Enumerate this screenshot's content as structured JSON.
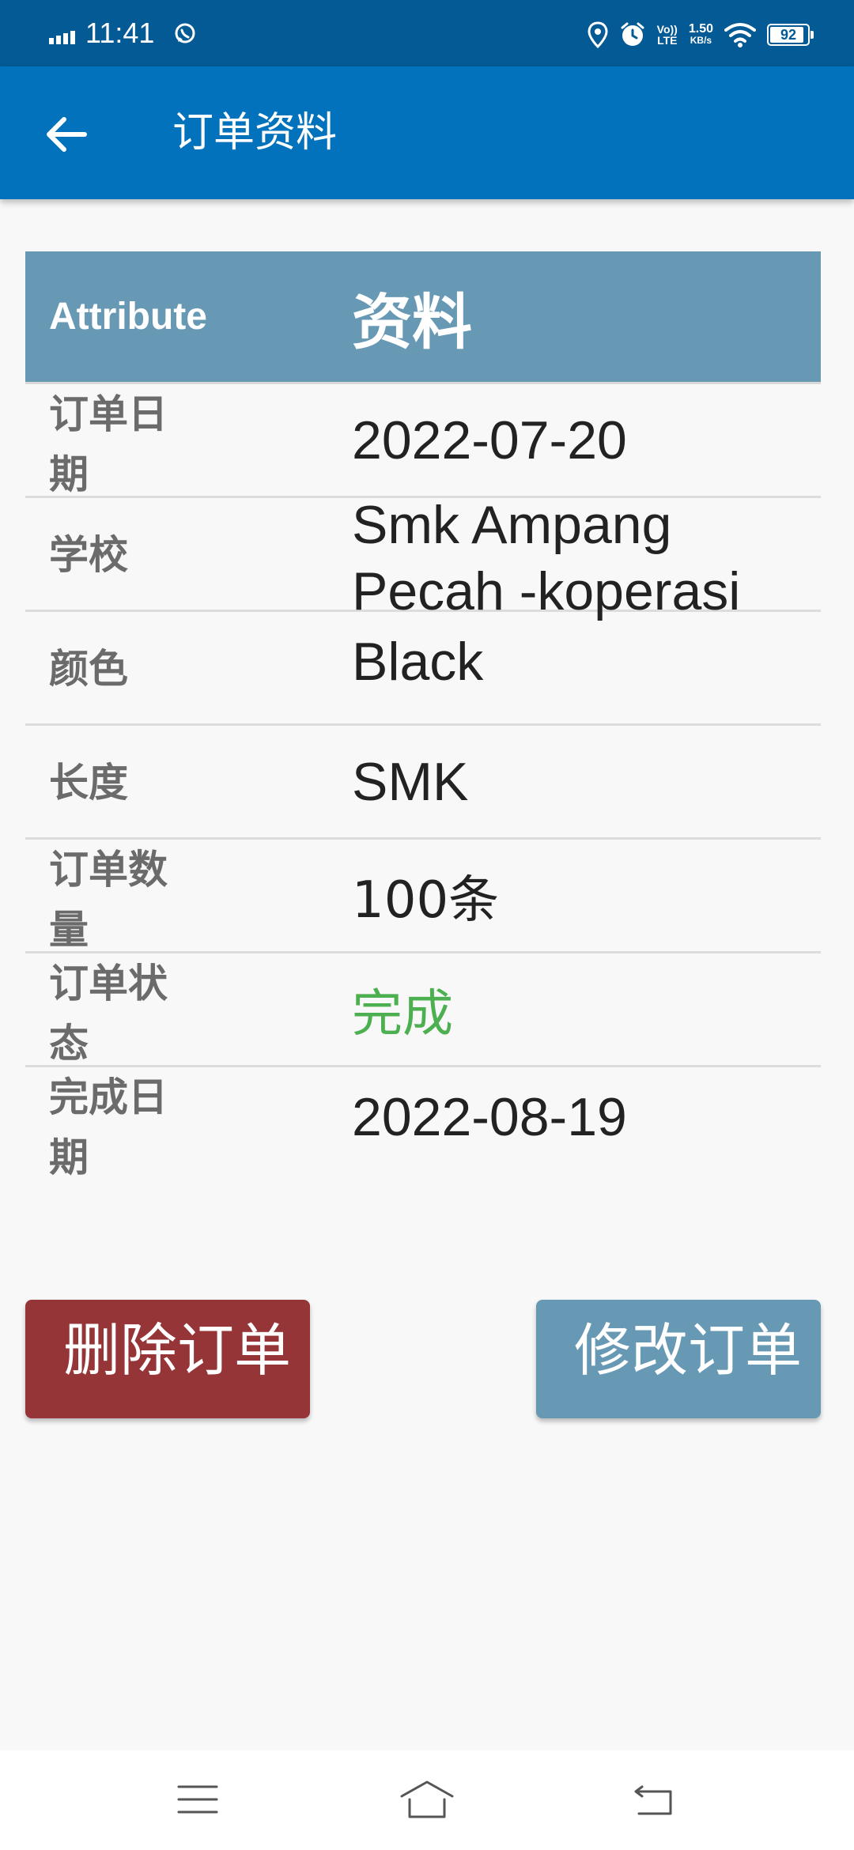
{
  "status_bar": {
    "time": "11:41",
    "net_speed_value": "1.50",
    "net_speed_unit": "KB/s",
    "volte_top": "Vo))",
    "volte_bottom": "LTE",
    "battery": "92",
    "battery_level": 0.92,
    "icons": [
      "signal-icon",
      "whatsapp-icon",
      "location-icon",
      "alarm-icon",
      "volte-icon",
      "wifi-icon",
      "battery-icon"
    ]
  },
  "app_bar": {
    "title": "订单资料",
    "back_icon": "arrow-left-icon"
  },
  "table": {
    "header": {
      "attribute": "Attribute",
      "data": "资料"
    },
    "rows": [
      {
        "label": "订单日期",
        "value": "2022-07-20"
      },
      {
        "label": "学校",
        "value": "Smk Ampang Pecah -koperasi"
      },
      {
        "label": "颜色",
        "value": "Black"
      },
      {
        "label": "长度",
        "value": "SMK"
      },
      {
        "label": "订单数量",
        "value": "100条"
      },
      {
        "label": "订单状态",
        "value": "完成"
      },
      {
        "label": "完成日期",
        "value": "2022-08-19"
      }
    ]
  },
  "buttons": {
    "delete": "删除订单",
    "edit": "修改订单"
  },
  "colors": {
    "status_bar": "#035a95",
    "app_bar": "#0272bd",
    "table_header": "#6799b5",
    "status_complete": "#4caf50",
    "delete_button": "#963537",
    "edit_button": "#6799b5"
  },
  "nav_bar": {
    "icons": [
      "menu-icon",
      "home-icon",
      "back-nav-icon"
    ]
  }
}
